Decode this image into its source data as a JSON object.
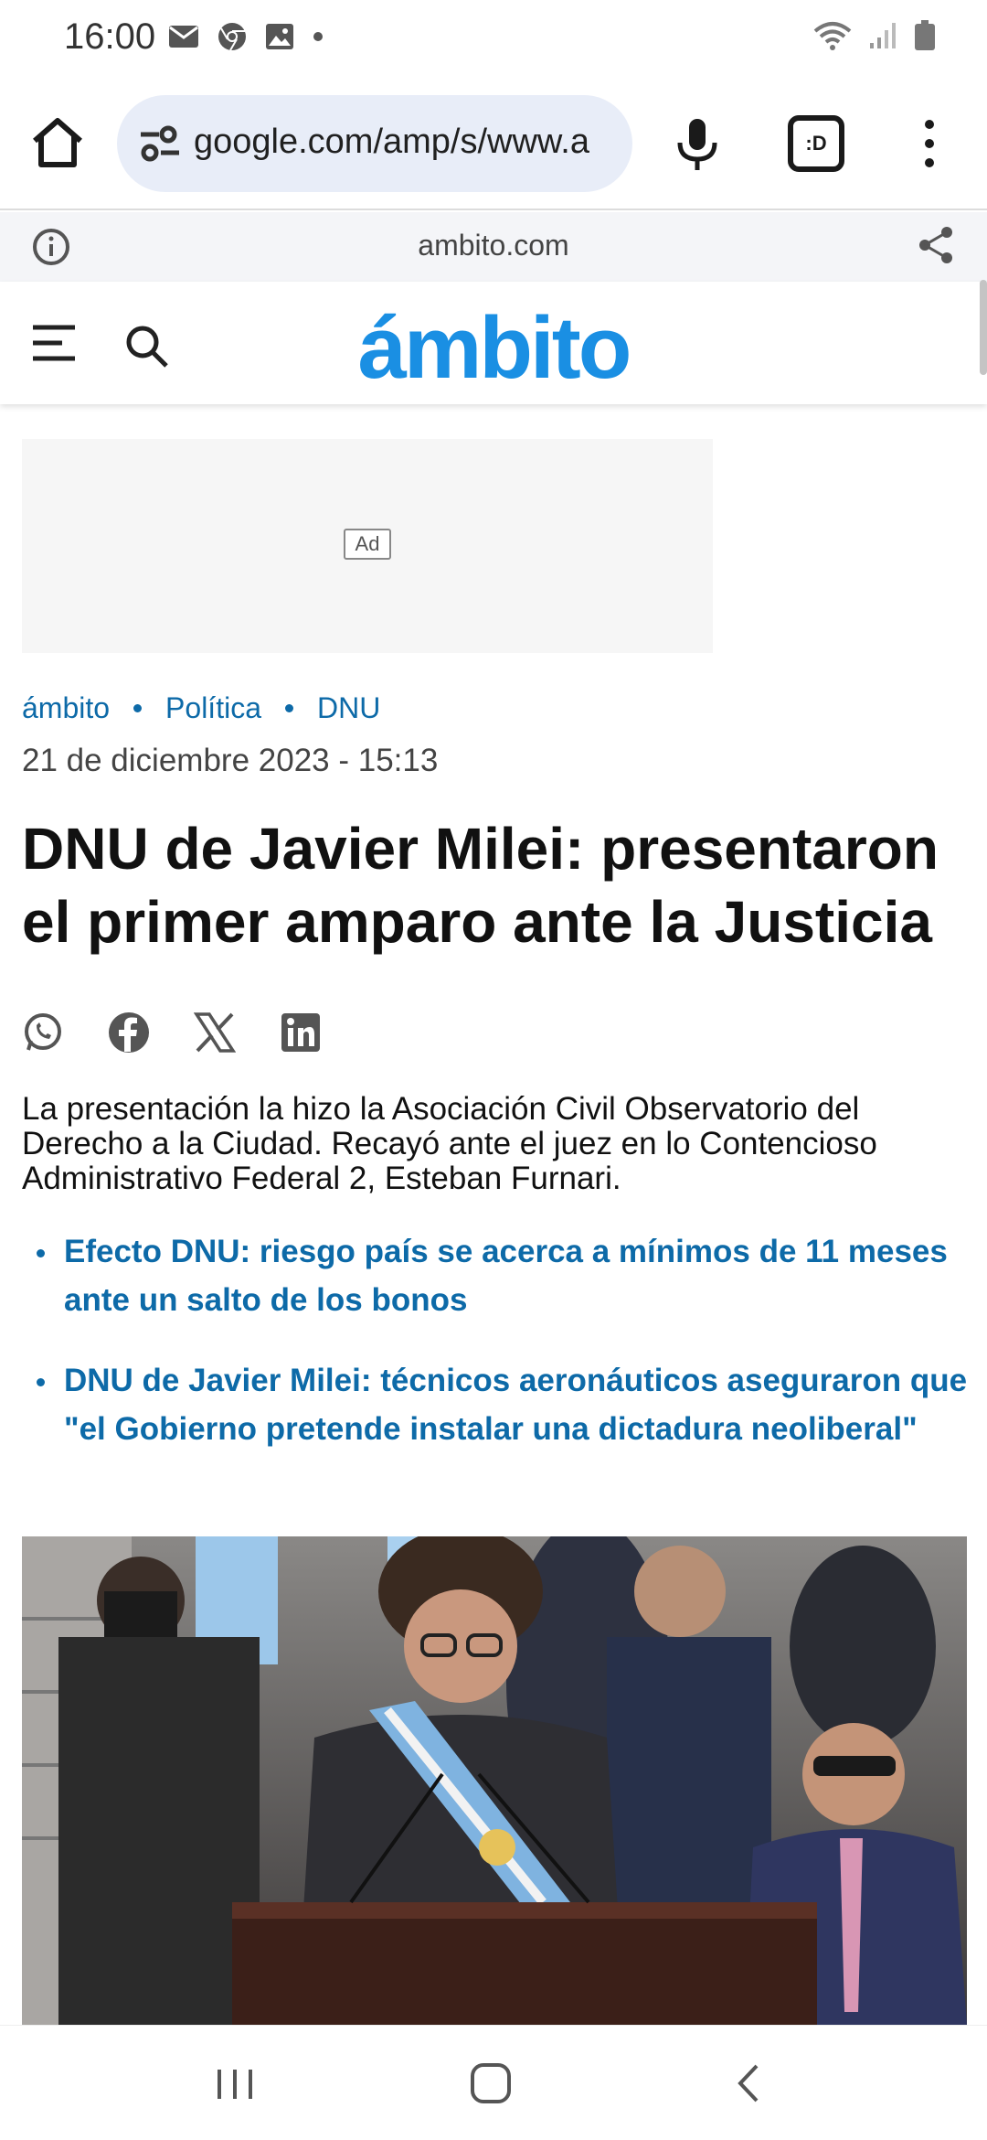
{
  "status_bar": {
    "time": "16:00"
  },
  "browser": {
    "url": "google.com/amp/s/www.a",
    "tab_label": ":D"
  },
  "amp_header": {
    "domain": "ambito.com"
  },
  "site": {
    "logo": "ámbito"
  },
  "ad": {
    "label": "Ad"
  },
  "article": {
    "breadcrumb": [
      "ámbito",
      "Política",
      "DNU"
    ],
    "date": "21 de diciembre 2023 - 15:13",
    "title": "DNU de Javier Milei: presentaron el primer amparo ante la Justicia",
    "summary": "La presentación la hizo la Asociación Civil Observatorio del Derecho a la Ciudad. Recayó ante el juez en lo Contencioso Administrativo Federal 2, Esteban Furnari.",
    "related": [
      "Efecto DNU: riesgo país se acerca a mínimos de 11 meses ante un salto de los bonos",
      "DNU de Javier Milei: técnicos aeronáuticos aseguraron que \"el Gobierno pretende instalar una dictadura neoliberal\""
    ],
    "share_icons": [
      "whatsapp-icon",
      "facebook-icon",
      "x-icon",
      "linkedin-icon"
    ]
  },
  "colors": {
    "brand": "#1a8fe3",
    "link": "#0d6aa8",
    "url_bar": "#e8edf8"
  }
}
